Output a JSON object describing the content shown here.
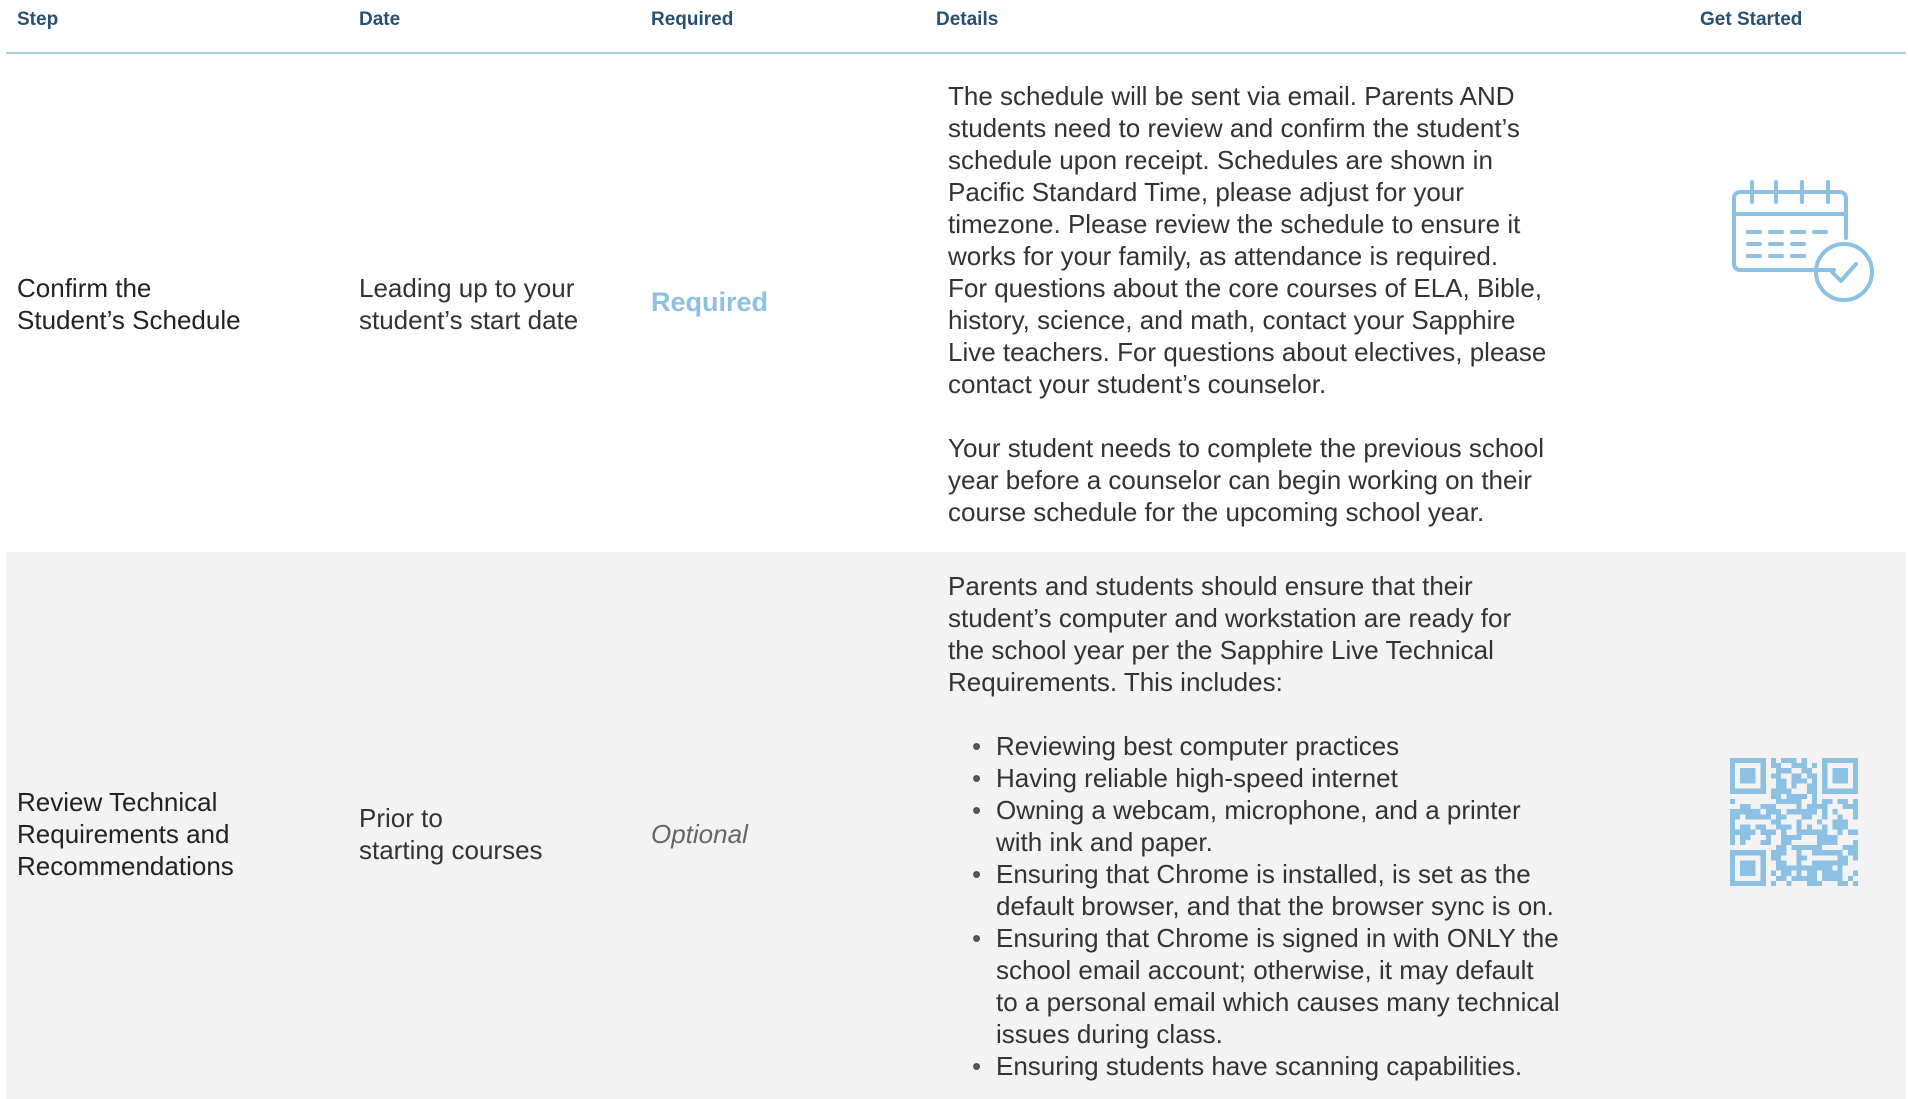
{
  "header": {
    "step": "Step",
    "date": "Date",
    "required": "Required",
    "details": "Details",
    "get_started": "Get Started"
  },
  "rows": [
    {
      "step": [
        "Confirm the",
        "Student’s Schedule"
      ],
      "date": [
        "Leading up to your",
        "student’s start date"
      ],
      "required": "Required",
      "details_paragraph_1": [
        "The schedule will be sent via email. Parents AND",
        "students need to review and confirm the student’s",
        "schedule upon receipt. Schedules are shown in",
        "Pacific Standard Time, please adjust for your",
        "timezone. Please review the schedule to ensure it",
        "works for your family, as attendance is required.",
        "For questions about the core courses of ELA, Bible,",
        "history, science, and math, contact your Sapphire",
        "Live teachers. For questions about electives, please",
        "contact your student’s counselor."
      ],
      "details_paragraph_2": [
        "Your student needs to complete the previous school",
        "year before a counselor can begin working on their",
        "course schedule for the upcoming school year."
      ],
      "icon": "calendar-clock-icon"
    },
    {
      "step": [
        "Review Technical",
        "Requirements and",
        "Recommendations"
      ],
      "date": [
        "Prior to",
        "starting courses"
      ],
      "required": "Optional",
      "details_intro": [
        "Parents and students should ensure that their",
        "student’s computer and workstation are ready for",
        "the school year per the Sapphire Live Technical",
        "Requirements. This includes:"
      ],
      "bullets": [
        [
          "Reviewing best computer practices"
        ],
        [
          "Having reliable high-speed internet"
        ],
        [
          "Owning a webcam, microphone, and a printer",
          "with ink and paper."
        ],
        [
          "Ensuring that Chrome is installed, is set as the",
          "default browser, and that the browser sync is on."
        ],
        [
          "Ensuring that Chrome is signed in with ONLY the",
          "school email account; otherwise, it may default",
          "to a personal email which causes many technical",
          "issues during class."
        ],
        [
          "Ensuring students have scanning capabilities."
        ]
      ],
      "icon": "qr-code-icon"
    }
  ],
  "colors": {
    "header_text": "#29506e",
    "header_rule": "#a9cfe8",
    "accent_blue": "#8cc1e4",
    "row_alt": "#f3f3f3"
  }
}
